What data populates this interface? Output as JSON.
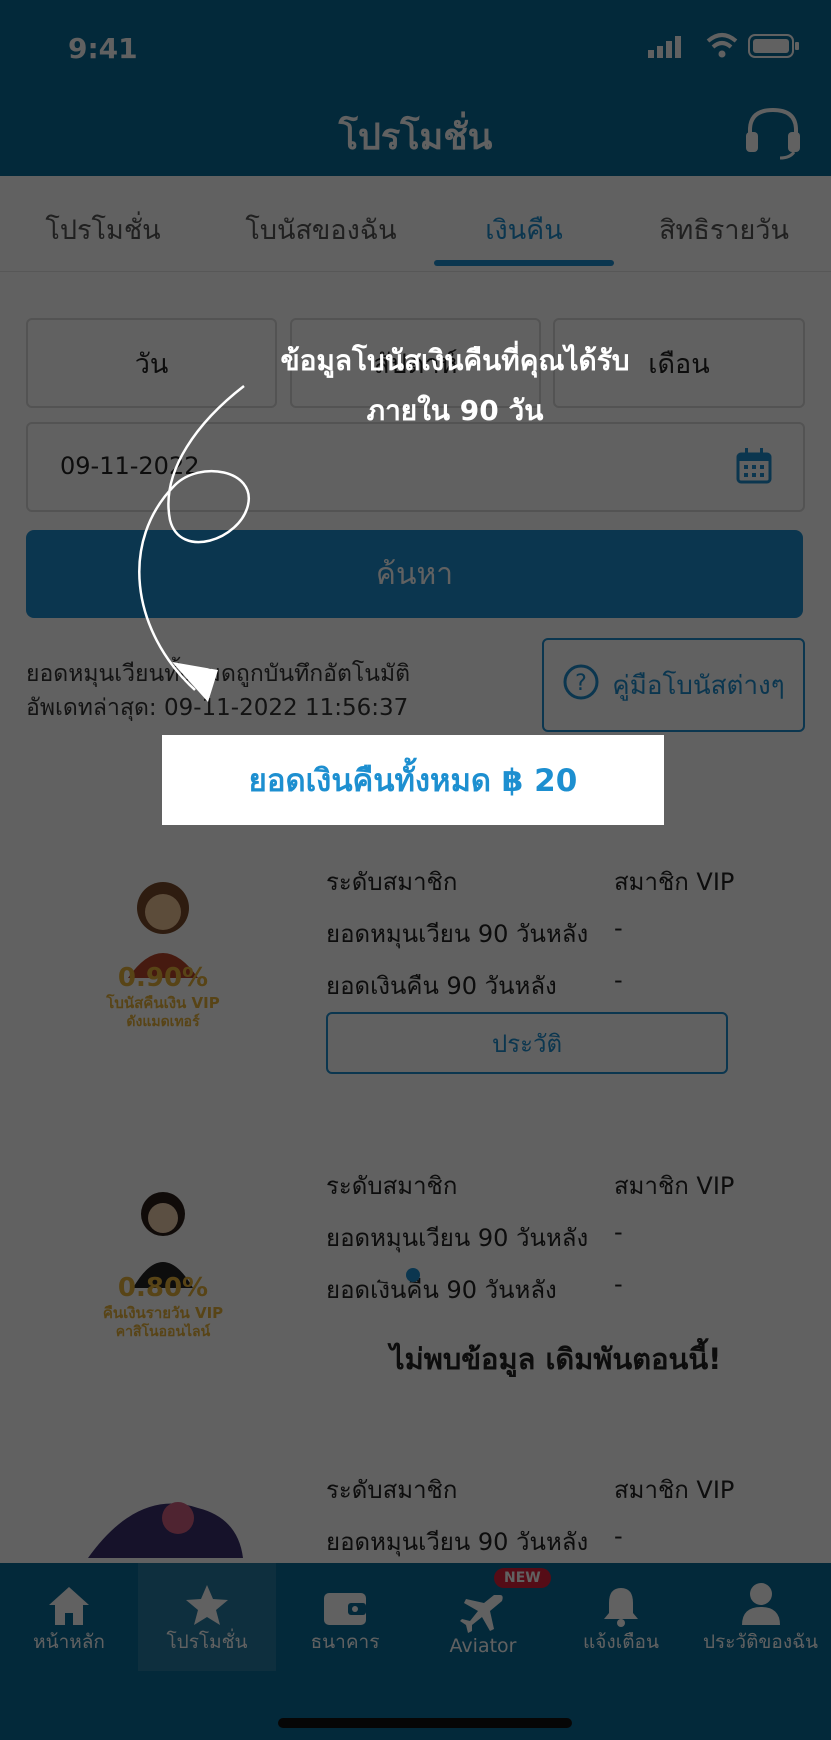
{
  "status": {
    "time": "9:41"
  },
  "header": {
    "title": "โปรโมชั่น"
  },
  "tabs": [
    {
      "label": "โปรโมชั่น"
    },
    {
      "label": "โบนัสของฉัน"
    },
    {
      "label": "เงินคืน"
    },
    {
      "label": "สิทธิรายวัน"
    }
  ],
  "range": {
    "day": "วัน",
    "week": "สัปดาห์",
    "month": "เดือน"
  },
  "date": {
    "value": "09-11-2022"
  },
  "search": {
    "label": "ค้นหา"
  },
  "info": {
    "line1": "ยอดหมุนเวียนทั้งหมดถูกบันทึกอัตโนมัติ",
    "line2": "อัพเดทล่าสุด: 09-11-2022 11:56:37"
  },
  "guide_button": {
    "label": "คู่มือโบนัสต่างๆ"
  },
  "total": {
    "label": "ยอดเงินคืนทั้งหมด ฿ 20"
  },
  "promos": [
    {
      "image_percent": "0.90%",
      "image_text1": "โบนัสคืนเงิน VIP",
      "image_text2": "ดังแมดเทอร์",
      "rows": [
        {
          "label": "ระดับสมาชิก",
          "value": "สมาชิก VIP"
        },
        {
          "label": "ยอดหมุนเวียน 90 วันหลัง",
          "value": "-"
        },
        {
          "label": "ยอดเงินคืน 90 วันหลัง",
          "value": "-"
        }
      ],
      "history": "ประวัติ"
    },
    {
      "image_percent": "0.80%",
      "image_text1": "คืนเงินรายวัน VIP",
      "image_text2": "คาสิโนออนไลน์",
      "rows": [
        {
          "label": "ระดับสมาชิก",
          "value": "สมาชิก VIP"
        },
        {
          "label": "ยอดหมุนเวียน 90 วันหลัง",
          "value": "-"
        },
        {
          "label": "ยอดเงินคืน 90 วันหลัง",
          "value": "-"
        }
      ]
    },
    {
      "rows": [
        {
          "label": "ระดับสมาชิก",
          "value": "สมาชิก VIP"
        },
        {
          "label": "ยอดหมุนเวียน 90 วันหลัง",
          "value": "-"
        }
      ]
    }
  ],
  "no_data": "ไม่พบข้อมูล เดิมพันตอนนี้!",
  "tooltip": {
    "line1": "ข้อมูลโบนัสเงินคืนที่คุณได้รับ",
    "line2": "ภายใน 90 วัน"
  },
  "nav": {
    "home": "หน้าหลัก",
    "promo": "โปรโมชั่น",
    "bank": "ธนาคาร",
    "aviator": "Aviator",
    "aviator_badge": "NEW",
    "notify": "แจ้งเตือน",
    "profile": "ประวัติของฉัน"
  },
  "colors": {
    "primary": "#0a6c98",
    "accent": "#1d8fd0",
    "badge": "#e0203a"
  }
}
